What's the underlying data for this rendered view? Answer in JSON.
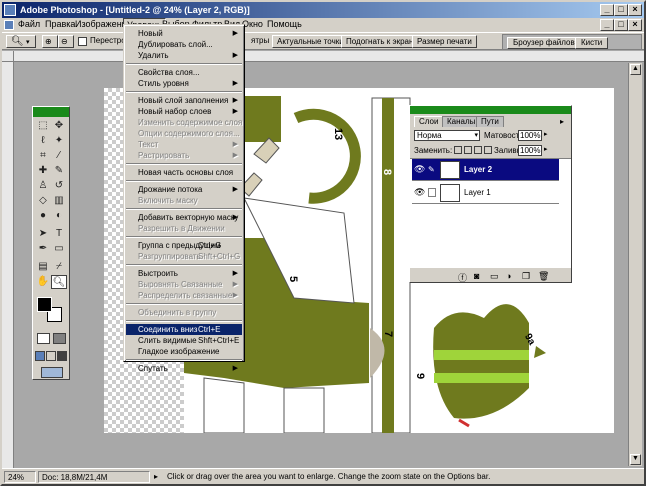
{
  "window": {
    "title": "Adobe Photoshop - [Untitled-2 @ 24% (Layer 2, RGB)]",
    "controls": [
      "_",
      "□",
      "×"
    ],
    "doc_controls": [
      "_",
      "□",
      "×"
    ]
  },
  "menubar": {
    "items": [
      "Файл",
      "Правка",
      "Изображение",
      "Уровень",
      "Выбор",
      "Фильтр",
      "Вид",
      "Окно",
      "Помощь"
    ],
    "active_index": 3
  },
  "options_bar": {
    "resize_label": "Перестроить",
    "buttons": [
      "Актуальные точки",
      "Подогнать к экрану",
      "Размер печати"
    ],
    "partial_label": "ятры",
    "well_tabs": [
      "Броузер файлов",
      "Кисти"
    ]
  },
  "status": {
    "zoom": "24%",
    "doc": "Doc: 18,8M/21,4M",
    "hint": "Click or drag over the area you want to enlarge. Change the zoom state on the Options bar."
  },
  "layer_menu": {
    "items": [
      {
        "label": "Новый",
        "arrow": true,
        "disabled": false
      },
      {
        "label": "Дублировать слой...",
        "disabled": false
      },
      {
        "label": "Удалить",
        "arrow": true,
        "disabled": false
      },
      {
        "sep": true
      },
      {
        "label": "Свойства слоя...",
        "disabled": false
      },
      {
        "label": "Стиль уровня",
        "arrow": true,
        "disabled": false
      },
      {
        "sep": true
      },
      {
        "label": "Новый слой заполнения",
        "arrow": true,
        "disabled": false
      },
      {
        "label": "Новый набор слоев",
        "arrow": true,
        "disabled": false
      },
      {
        "label": "Изменить содержимое слоя",
        "disabled": true
      },
      {
        "label": "Опции содержимого слоя...",
        "disabled": true
      },
      {
        "label": "Текст",
        "arrow": true,
        "disabled": true
      },
      {
        "label": "Растрировать",
        "arrow": true,
        "disabled": true
      },
      {
        "sep": true
      },
      {
        "label": "Новая часть основы слоя",
        "disabled": false
      },
      {
        "sep": true
      },
      {
        "label": "Дрожание потока",
        "arrow": true,
        "disabled": false
      },
      {
        "label": "Включить маску",
        "disabled": true
      },
      {
        "sep": true
      },
      {
        "label": "Добавить векторную маску",
        "arrow": true,
        "disabled": false
      },
      {
        "label": "Разрешить в Движении",
        "disabled": true
      },
      {
        "sep": true
      },
      {
        "label": "Группа с предыдущим",
        "shortcut": "Ctrl+G",
        "disabled": false
      },
      {
        "label": "Разгруппировать",
        "shortcut": "Shft+Ctrl+G",
        "disabled": true
      },
      {
        "sep": true
      },
      {
        "label": "Выстроить",
        "arrow": true,
        "disabled": false
      },
      {
        "label": "Выровнять Связанные",
        "arrow": true,
        "disabled": true
      },
      {
        "label": "Распределить связанные",
        "arrow": true,
        "disabled": true
      },
      {
        "sep": true
      },
      {
        "label": "Объединить в группу",
        "disabled": true
      },
      {
        "sep": true
      },
      {
        "label": "Соединить вниз",
        "shortcut": "Ctrl+E",
        "disabled": false,
        "highlighted": true
      },
      {
        "label": "Слить видимые",
        "shortcut": "Shft+Ctrl+E",
        "disabled": false
      },
      {
        "label": "Гладкое изображение",
        "disabled": false
      },
      {
        "sep": true
      },
      {
        "label": "Спутать",
        "arrow": true,
        "disabled": false
      }
    ]
  },
  "layers_panel": {
    "tabs": [
      "Слои",
      "Каналы",
      "Пути"
    ],
    "blend_mode": "Норма",
    "opacity_label": "Матовость:",
    "opacity_value": "100%",
    "lock_label": "Заменить:",
    "fill_label": "Заливка:",
    "fill_value": "100%",
    "layers": [
      {
        "name": "Layer 2",
        "selected": true
      },
      {
        "name": "Layer 1",
        "selected": false
      }
    ]
  },
  "canvas_labels": [
    "13",
    "8",
    "5",
    "7",
    "9",
    "9a"
  ],
  "colors": {
    "olive": "#6f7a1e",
    "lime": "#9fd43a",
    "menu_highlight": "#0a246a",
    "panel_title": "#1a8a1a"
  }
}
